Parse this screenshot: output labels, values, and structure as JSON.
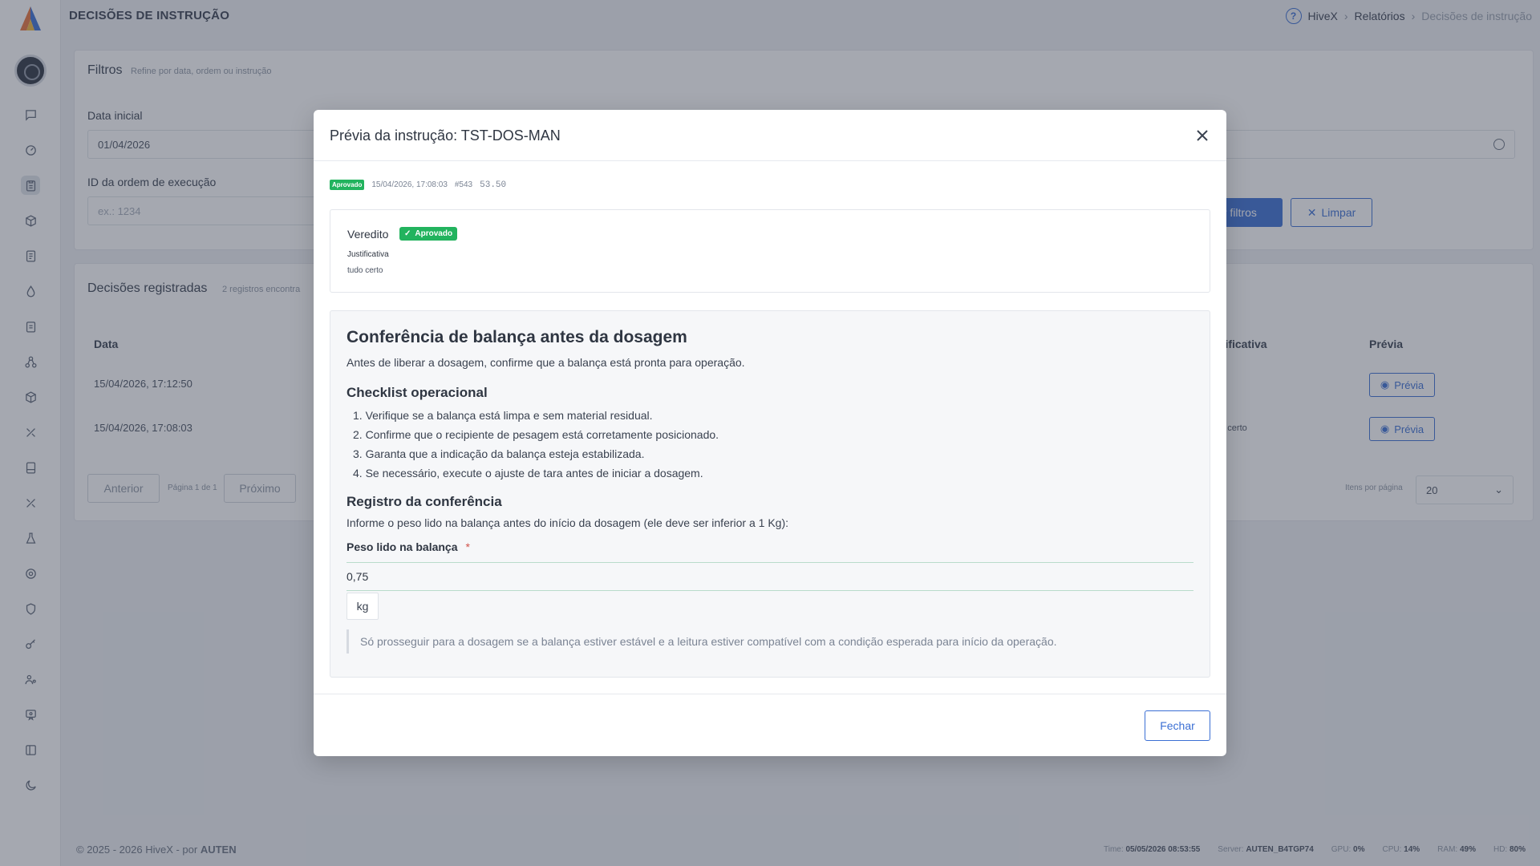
{
  "topbar": {
    "page_title": "DECISÕES DE INSTRUÇÃO",
    "breadcrumb": [
      "HiveX",
      "Relatórios",
      "Decisões de instrução"
    ]
  },
  "filters": {
    "title": "Filtros",
    "subtitle": "Refine por data, ordem ou instrução",
    "start_date_label": "Data inicial",
    "start_date_value": "01/04/2026",
    "order_id_label": "ID da ordem de execução",
    "order_id_placeholder": "ex.: 1234",
    "apply_label": "ar filtros",
    "clear_label": "Limpar"
  },
  "decisions": {
    "title": "Decisões registradas",
    "subtitle": "2 registros encontra",
    "columns": {
      "date": "Data",
      "justification": "stificativa",
      "preview": "Prévia"
    },
    "rows": [
      {
        "date": "15/04/2026, 17:12:50",
        "justification": "",
        "preview": "Prévia"
      },
      {
        "date": "15/04/2026, 17:08:03",
        "justification": "do certo",
        "preview": "Prévia"
      }
    ],
    "prev_label": "Anterior",
    "page_info": "Página 1 de 1",
    "next_label": "Próximo",
    "per_page_label": "Itens por página",
    "per_page_value": "20"
  },
  "footer": {
    "copyright_prefix": "© 2025 - 2026 HiveX - por ",
    "copyright_brand": "AUTEN",
    "time_label": "Time:",
    "time_value": "05/05/2026 08:53:55",
    "server_label": "Server:",
    "server_value": "AUTEN_B4TGP74",
    "gpu_label": "GPU:",
    "gpu_value": "0%",
    "cpu_label": "CPU:",
    "cpu_value": "14%",
    "ram_label": "RAM:",
    "ram_value": "49%",
    "hd_label": "HD:",
    "hd_value": "80%"
  },
  "modal": {
    "title": "Prévia da instrução: TST-DOS-MAN",
    "meta": {
      "status_badge": "Aprovado",
      "timestamp": "15/04/2026, 17:08:03",
      "id": "#543",
      "code": "53.50"
    },
    "verdict": {
      "label": "Veredito",
      "badge": "Aprovado",
      "justification_label": "Justificativa",
      "justification_value": "tudo certo"
    },
    "content": {
      "heading": "Conferência de balança antes da dosagem",
      "intro": "Antes de liberar a dosagem, confirme que a balança está pronta para operação.",
      "checklist_title": "Checklist operacional",
      "checklist": [
        "1. Verifique se a balança está limpa e sem material residual.",
        "2. Confirme que o recipiente de pesagem está corretamente posicionado.",
        "3. Garanta que a indicação da balança esteja estabilizada.",
        "4. Se necessário, execute o ajuste de tara antes de iniciar a dosagem."
      ],
      "record_title": "Registro da conferência",
      "record_text": "Informe o peso lido na balança antes do início da dosagem (ele deve ser inferior a 1 Kg):",
      "weight_label": "Peso lido na balança",
      "required_mark": "*",
      "weight_value": "0,75",
      "unit": "kg",
      "note": "Só prosseguir para a dosagem se a balança estiver estável e a leitura estiver compatível com a condição esperada para início da operação."
    },
    "close_label": "Fechar"
  },
  "colors": {
    "primary": "#3b6fd4",
    "success": "#22b35e",
    "overlay": "#373e50"
  }
}
